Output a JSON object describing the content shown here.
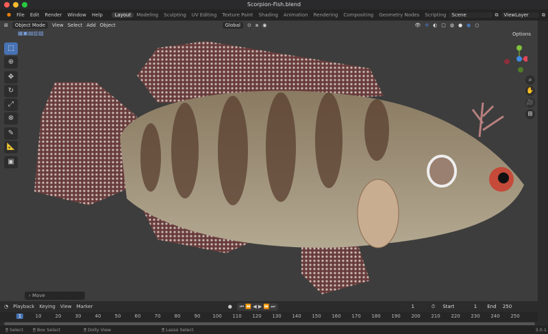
{
  "window": {
    "title": "Scorpion-Fish.blend"
  },
  "menu": [
    "File",
    "Edit",
    "Render",
    "Window",
    "Help"
  ],
  "workspaces": [
    "Layout",
    "Modeling",
    "Sculpting",
    "UV Editing",
    "Texture Paint",
    "Shading",
    "Animation",
    "Rendering",
    "Compositing",
    "Geometry Nodes",
    "Scripting"
  ],
  "active_workspace": "Layout",
  "scene": "Scene",
  "view_layer": "ViewLayer",
  "viewport": {
    "mode": "Object Mode",
    "menus": [
      "View",
      "Select",
      "Add",
      "Object"
    ],
    "orientation": "Global",
    "options_label": "Options",
    "last_operator": "Move"
  },
  "toolbar_icons": [
    "select-box-icon",
    "cursor-icon",
    "move-icon",
    "rotate-icon",
    "scale-icon",
    "transform-icon",
    "annotate-icon",
    "measure-icon",
    "add-cube-icon"
  ],
  "timeline": {
    "menus": [
      "Playback",
      "Keying",
      "View",
      "Marker"
    ],
    "current_frame": "1",
    "start_label": "Start",
    "start": "1",
    "end_label": "End",
    "end": "250",
    "ticks": [
      "1",
      "10",
      "20",
      "30",
      "40",
      "50",
      "60",
      "70",
      "80",
      "90",
      "100",
      "110",
      "120",
      "130",
      "140",
      "150",
      "160",
      "170",
      "180",
      "190",
      "200",
      "210",
      "220",
      "230",
      "240",
      "250"
    ]
  },
  "status": {
    "items": [
      "Select",
      "Box Select",
      "Dolly View",
      "Lasso Select"
    ],
    "version": "3.0.1"
  },
  "colors": {
    "accent": "#4772b3",
    "x_axis": "#e4465a",
    "y_axis": "#7fc33c",
    "z_axis": "#3d8be0"
  }
}
